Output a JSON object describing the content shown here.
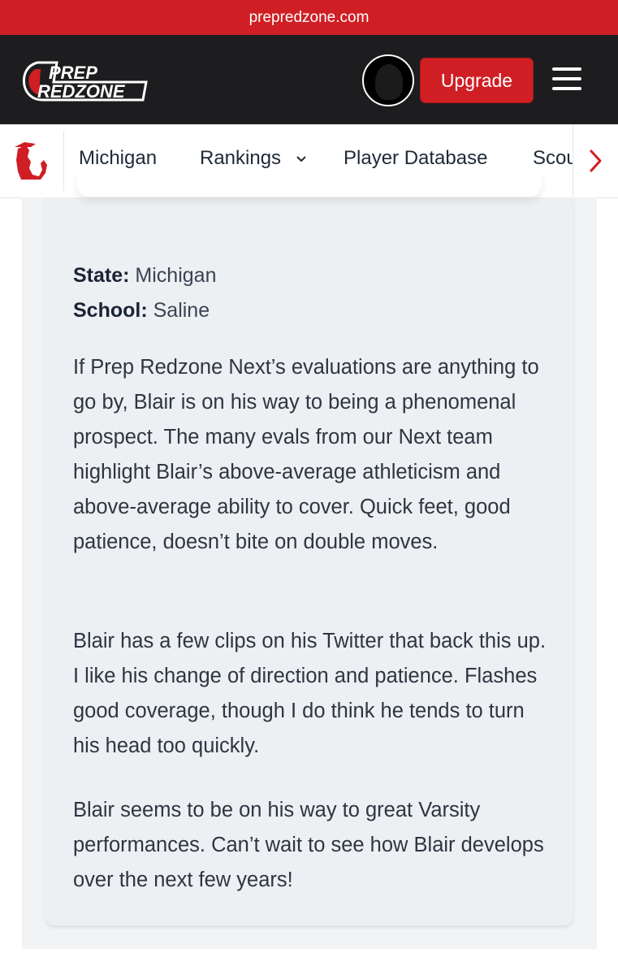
{
  "browser": {
    "url": "prepredzone.com"
  },
  "header": {
    "logo_top": "PREP",
    "logo_bottom": "REDZONE",
    "upgrade_label": "Upgrade"
  },
  "subnav": {
    "items": [
      {
        "label": "Michigan"
      },
      {
        "label": "Rankings"
      },
      {
        "label": "Player Database"
      },
      {
        "label": "Scou"
      }
    ]
  },
  "profile": {
    "state_label": "State:",
    "state_value": "Michigan",
    "school_label": "School:",
    "school_value": "Saline"
  },
  "article": {
    "paragraphs": [
      "If Prep Redzone Next’s evaluations are anything to go by, Blair is on his way to being a phenomenal prospect. The many evals from our Next team highlight Blair’s above-average athleticism and above-average ability to cover. Quick feet, good patience, doesn’t bite on double moves.",
      "Blair has a few clips on his Twitter that back this up. I like his change of direction and patience. Flashes good coverage, though I do think he tends to turn his head too quickly.",
      "Blair seems to be on his way to great Varsity performances. Can’t wait to see how Blair develops over the next few years!"
    ]
  },
  "colors": {
    "brand_red": "#cf1f24",
    "header_dark": "#1d1d1f",
    "card_bg": "#ecf0f3"
  }
}
